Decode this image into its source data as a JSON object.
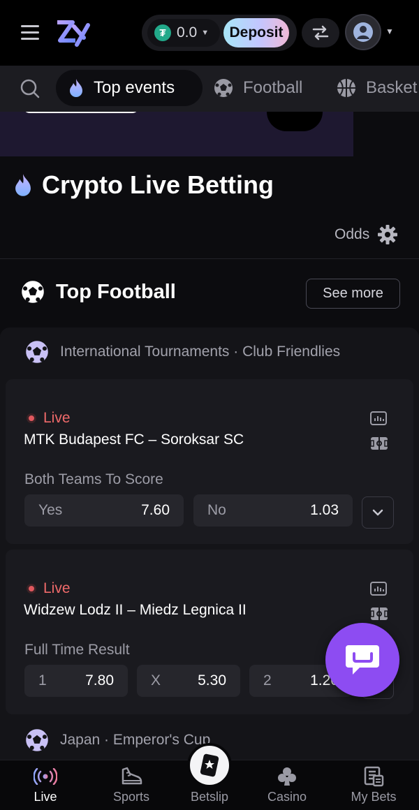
{
  "header": {
    "balance": "0.0",
    "coin_symbol": "₮",
    "deposit_label": "Deposit"
  },
  "categories": [
    {
      "label": "Top events",
      "icon": "fire-icon",
      "active": true
    },
    {
      "label": "Football",
      "icon": "football-icon",
      "active": false
    },
    {
      "label": "Basket",
      "icon": "basketball-icon",
      "active": false
    }
  ],
  "page": {
    "title": "Crypto Live Betting",
    "odds_label": "Odds"
  },
  "section": {
    "title": "Top Football",
    "see_more": "See more"
  },
  "leagues": [
    {
      "name": "International Tournaments · Club Friendlies"
    },
    {
      "name": "Japan · Emperor's Cup"
    }
  ],
  "matches": [
    {
      "status": "Live",
      "teams": "MTK Budapest FC – Soroksar SC",
      "market": "Both Teams To Score",
      "odds": [
        {
          "label": "Yes",
          "value": "7.60"
        },
        {
          "label": "No",
          "value": "1.03"
        }
      ]
    },
    {
      "status": "Live",
      "teams": "Widzew Lodz II – Miedz Legnica II",
      "market": "Full Time Result",
      "odds": [
        {
          "label": "1",
          "value": "7.80"
        },
        {
          "label": "X",
          "value": "5.30"
        },
        {
          "label": "2",
          "value": "1.20"
        }
      ]
    }
  ],
  "bottom_nav": [
    {
      "label": "Live",
      "icon": "live-broadcast-icon",
      "active": true
    },
    {
      "label": "Sports",
      "icon": "sneaker-icon",
      "active": false
    },
    {
      "label": "Betslip",
      "icon": "betslip-ticket-icon",
      "active": false
    },
    {
      "label": "Casino",
      "icon": "club-suit-icon",
      "active": false
    },
    {
      "label": "My Bets",
      "icon": "receipt-icon",
      "active": false
    }
  ],
  "colors": {
    "accent_purple": "#8d4cf2",
    "live_red": "#ef6a6a",
    "background": "#0c0c0f"
  }
}
